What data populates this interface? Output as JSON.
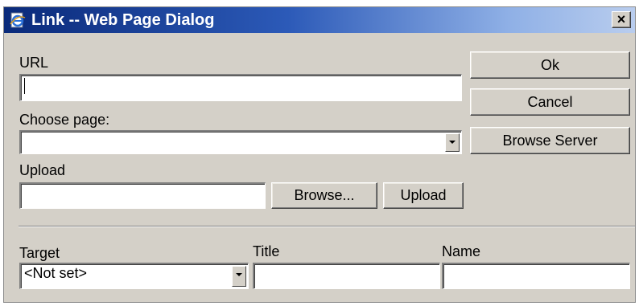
{
  "window": {
    "title": "Link -- Web Page Dialog",
    "close_label": "×"
  },
  "url": {
    "label": "URL",
    "value": ""
  },
  "choose_page": {
    "label": "Choose page:",
    "selected": ""
  },
  "upload": {
    "label": "Upload",
    "value": "",
    "browse_label": "Browse...",
    "upload_label": "Upload"
  },
  "buttons": {
    "ok": "Ok",
    "cancel": "Cancel",
    "browse_server": "Browse Server"
  },
  "target": {
    "label": "Target",
    "selected": "<Not set>"
  },
  "title_field": {
    "label": "Title",
    "value": ""
  },
  "name_field": {
    "label": "Name",
    "value": ""
  },
  "colors": {
    "dialog_bg": "#d4d0c8",
    "titlebar_start": "#0a2a7a",
    "titlebar_end": "#b9cdee"
  },
  "icons": {
    "title": "ie-page-icon",
    "dropdown": "chevron-down-icon"
  }
}
